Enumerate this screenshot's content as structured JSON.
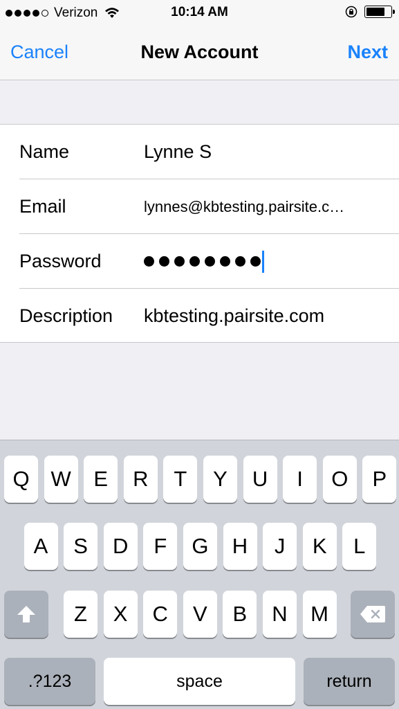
{
  "status_bar": {
    "carrier": "Verizon",
    "time": "10:14 AM",
    "signal_bars": 4,
    "signal_max": 5,
    "battery_level": 0.75
  },
  "nav": {
    "cancel_label": "Cancel",
    "title": "New Account",
    "next_label": "Next"
  },
  "form": {
    "name_label": "Name",
    "name_value": "Lynne S",
    "email_label": "Email",
    "email_value": "lynnes@kbtesting.pairsite.c…",
    "password_label": "Password",
    "password_length": 8,
    "description_label": "Description",
    "description_value": "kbtesting.pairsite.com"
  },
  "keyboard": {
    "row1": [
      "Q",
      "W",
      "E",
      "R",
      "T",
      "Y",
      "U",
      "I",
      "O",
      "P"
    ],
    "row2": [
      "A",
      "S",
      "D",
      "F",
      "G",
      "H",
      "J",
      "K",
      "L"
    ],
    "row3": [
      "Z",
      "X",
      "C",
      "V",
      "B",
      "N",
      "M"
    ],
    "numbers_label": ".?123",
    "space_label": "space",
    "return_label": "return",
    "shift_icon": "shift-arrow-icon",
    "delete_icon": "backspace-icon"
  },
  "colors": {
    "accent": "#1a82fb",
    "keyboard_bg": "#d1d5db",
    "dark_key": "#abb1ba"
  }
}
